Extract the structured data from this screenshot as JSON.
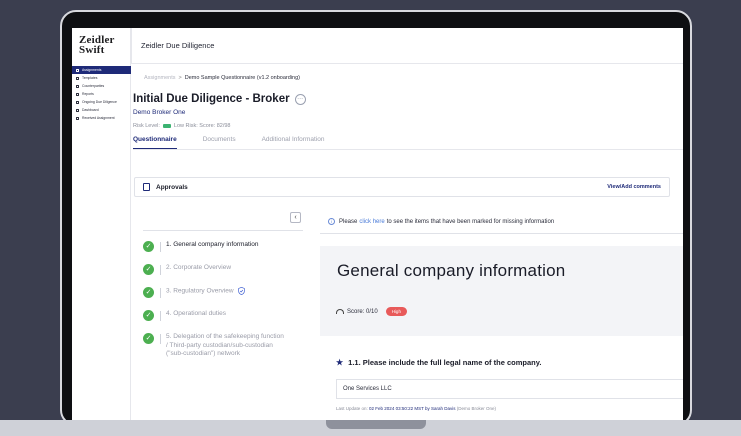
{
  "app": {
    "logo_line1": "Zeidler",
    "logo_line2": "Swift",
    "title": "Zeidler Due Dilligence"
  },
  "sidebar": {
    "items": [
      {
        "label": "Assignments"
      },
      {
        "label": "Templates"
      },
      {
        "label": "Counterparties"
      },
      {
        "label": "Reports"
      },
      {
        "label": "Ongoing Due Diligence"
      },
      {
        "label": "Dashboard"
      },
      {
        "label": "Received Assignment"
      }
    ]
  },
  "breadcrumb": {
    "root": "Assignments",
    "separator": ">",
    "current": "Demo Sample Questionnaire (v1.2 onboarding)"
  },
  "header": {
    "title": "Initial Due Diligence - Broker",
    "more": "···",
    "broker": "Demo Broker One",
    "risk_label": "Risk Level:",
    "risk_text": "Low Risk: Score: 82/98"
  },
  "tabs": [
    {
      "label": "Questionnaire"
    },
    {
      "label": "Documents"
    },
    {
      "label": "Additional Information"
    }
  ],
  "approvals": {
    "label": "Approvals",
    "link": "View/Add comments"
  },
  "nav": {
    "collapse": "‹",
    "items": [
      {
        "label": "1. General company information"
      },
      {
        "label": "2. Corporate Overview"
      },
      {
        "label": "3. Regulatory Overview"
      },
      {
        "label": "4. Operational duties"
      },
      {
        "label": "5. Delegation of the safekeeping function / Third-party custodian/sub-custodian (\"sub-custodian\") network"
      }
    ]
  },
  "notice": {
    "info": "i",
    "pre": "Please",
    "link": "click here",
    "post": "to see the items that have been marked for missing information"
  },
  "section": {
    "title": "General company information",
    "score": "Score: 0/10",
    "badge": "High"
  },
  "question": {
    "star": "★",
    "text": "1.1. Please include the full legal name of the company.",
    "answer": "One Services LLC",
    "update_prefix": "Last Update on:",
    "update_date": "02 Feb 2024 03:50:22 MST by Sarah Davis",
    "update_suffix": "(Demo Broker One)"
  },
  "colors": {
    "brand": "#1e2a78",
    "check": "#4caf50",
    "badge_high": "#e85a5a"
  }
}
